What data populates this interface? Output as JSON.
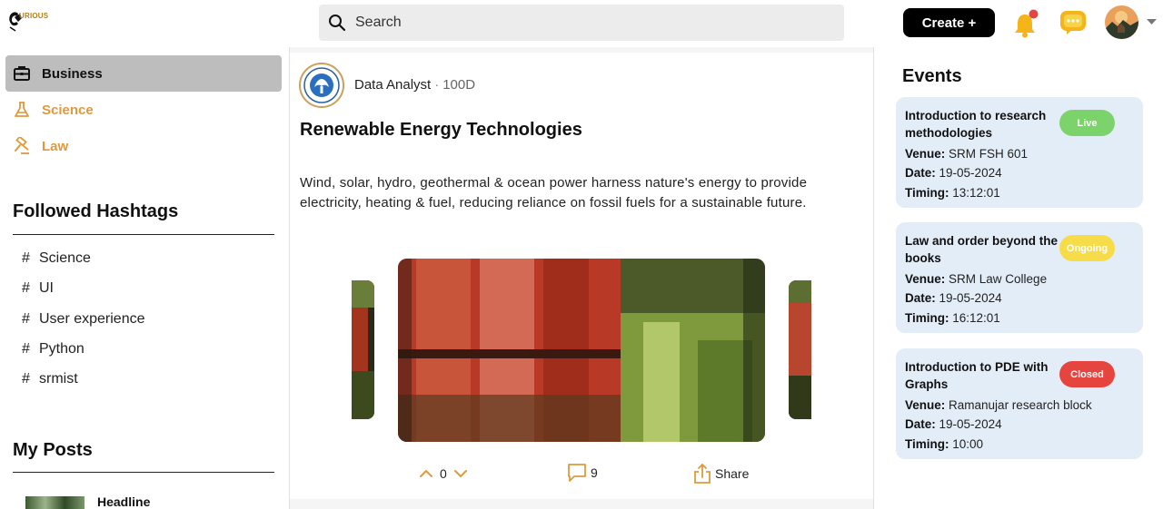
{
  "header": {
    "logo_text": "URIOUS",
    "search_placeholder": "Search",
    "create_label": "Create +"
  },
  "sidebar": {
    "categories": [
      {
        "label": "Business",
        "active": true
      },
      {
        "label": "Science",
        "active": false
      },
      {
        "label": "Law",
        "active": false
      }
    ],
    "hashtags_title": "Followed Hashtags",
    "hashtags": [
      "Science",
      "UI",
      "User experience",
      "Python",
      "srmist"
    ],
    "hash_symbol": "#",
    "my_posts_title": "My Posts",
    "my_posts": [
      {
        "label": "Headline"
      }
    ]
  },
  "post": {
    "author": "Data Analyst",
    "separator": "·",
    "age": "100D",
    "title": "Renewable Energy Technologies",
    "body": "Wind, solar, hydro, geothermal & ocean power harness nature's energy to provide electricity, heating & fuel, reducing reliance on fossil fuels for a sustainable future.",
    "votes": "0",
    "comments": "9",
    "share_label": "Share"
  },
  "events": {
    "title": "Events",
    "venue_label": "Venue:",
    "date_label": "Date:",
    "timing_label": "Timing:",
    "items": [
      {
        "title": "Introduction to research methodologies",
        "status": "Live",
        "venue": "SRM FSH 601",
        "date": "19-05-2024",
        "timing": "13:12:01"
      },
      {
        "title": "Law and order beyond the books",
        "status": "Ongoing",
        "venue": "SRM Law College",
        "date": "19-05-2024",
        "timing": "16:12:01"
      },
      {
        "title": "Introduction to PDE with Graphs",
        "status": "Closed",
        "venue": "Ramanujar research block",
        "date": "19-05-2024",
        "timing": "10:00"
      }
    ]
  },
  "colors": {
    "accent_orange": "#e09a3a",
    "live": "#7dd36b",
    "ongoing": "#f7dc4a",
    "closed": "#e6453f",
    "event_card_bg": "#e3edf7"
  }
}
